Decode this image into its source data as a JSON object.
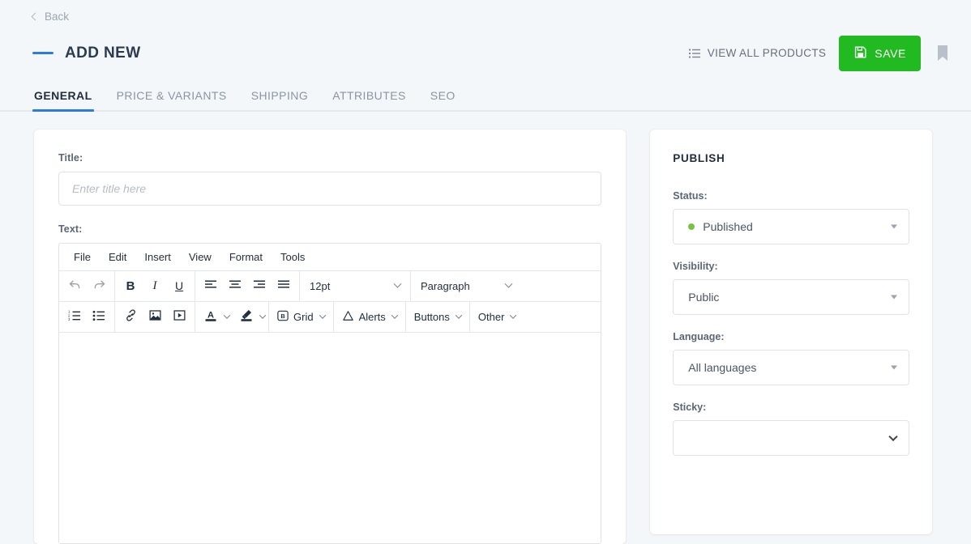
{
  "header": {
    "back_label": "Back",
    "title": "ADD NEW",
    "view_all_label": "VIEW ALL PRODUCTS",
    "save_label": "SAVE",
    "accent_color": "#2d7ae5",
    "save_color": "#21ba21"
  },
  "tabs": [
    {
      "label": "GENERAL",
      "active": true
    },
    {
      "label": "PRICE & VARIANTS",
      "active": false
    },
    {
      "label": "SHIPPING",
      "active": false
    },
    {
      "label": "ATTRIBUTES",
      "active": false
    },
    {
      "label": "SEO",
      "active": false
    }
  ],
  "form": {
    "title_label": "Title:",
    "title_value": "",
    "title_placeholder": "Enter title here",
    "text_label": "Text:"
  },
  "editor": {
    "menu": [
      "File",
      "Edit",
      "Insert",
      "View",
      "Format",
      "Tools"
    ],
    "row1": {
      "undo": "undo-icon",
      "redo": "redo-icon",
      "bold": "B",
      "italic": "I",
      "underline": "U",
      "align_left": "align-left-icon",
      "align_center": "align-center-icon",
      "align_right": "align-right-icon",
      "align_justify": "align-justify-icon",
      "font_size": "12pt",
      "block_format": "Paragraph"
    },
    "row2": {
      "numbered_list": "numbered-list-icon",
      "bullet_list": "bullet-list-icon",
      "link": "link-icon",
      "image": "image-icon",
      "media": "media-icon",
      "text_color": "text-color-icon",
      "highlight_color": "highlight-color-icon",
      "grid": "Grid",
      "alerts": "Alerts",
      "buttons": "Buttons",
      "other": "Other"
    },
    "content": ""
  },
  "publish": {
    "panel_title": "PUBLISH",
    "status_label": "Status:",
    "status_value": "Published",
    "status_dot_color": "#7ac142",
    "visibility_label": "Visibility:",
    "visibility_value": "Public",
    "language_label": "Language:",
    "language_value": "All languages",
    "sticky_label": "Sticky:",
    "sticky_value": ""
  }
}
